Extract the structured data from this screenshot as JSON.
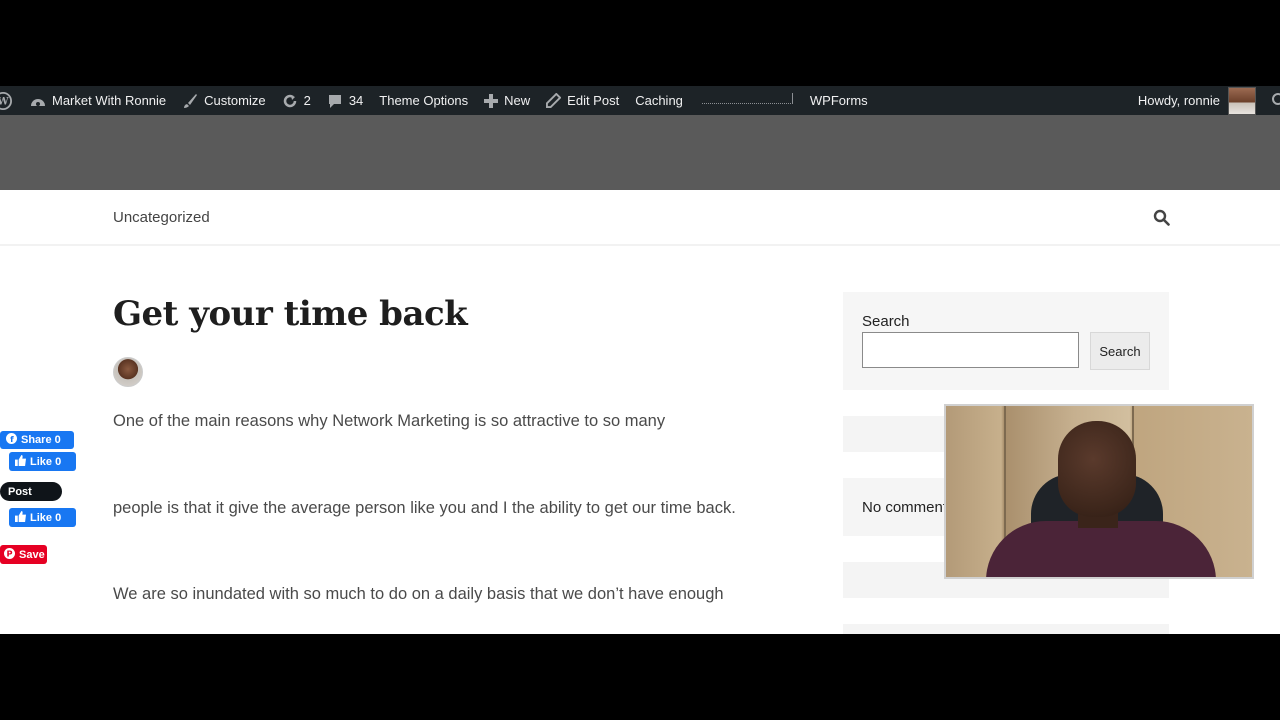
{
  "adminbar": {
    "site_name": "Market With Ronnie",
    "customize": "Customize",
    "updates_count": "2",
    "comments_count": "34",
    "theme_options": "Theme Options",
    "new": "New",
    "edit_post": "Edit Post",
    "caching": "Caching",
    "wpforms": "WPForms",
    "howdy": "Howdy, ronnie"
  },
  "header": {
    "site_title": "Market With Ronnie"
  },
  "nav": {
    "category": "Uncategorized"
  },
  "post": {
    "title": "Get your time back",
    "paragraphs": [
      "One of the main reasons why Network Marketing is so attractive to so many",
      "people is that it give the average person like you and I the ability to get our time back.",
      "We are so inundated with so much to do on a daily basis that we don’t have enough"
    ]
  },
  "sidebar": {
    "search_label": "Search",
    "search_button": "Search",
    "search_value": "",
    "comments_text": "No comments to show."
  },
  "share": {
    "fb_share": "Share 0",
    "fb_like_1": "Like 0",
    "x_post": "Post",
    "fb_like_2": "Like 0",
    "pin_save": "Save"
  },
  "colors": {
    "adminbar_bg": "#1d2327",
    "header_bg": "#5a5a5a",
    "facebook": "#1877f2",
    "x": "#0f1419",
    "pinterest": "#e60023"
  }
}
